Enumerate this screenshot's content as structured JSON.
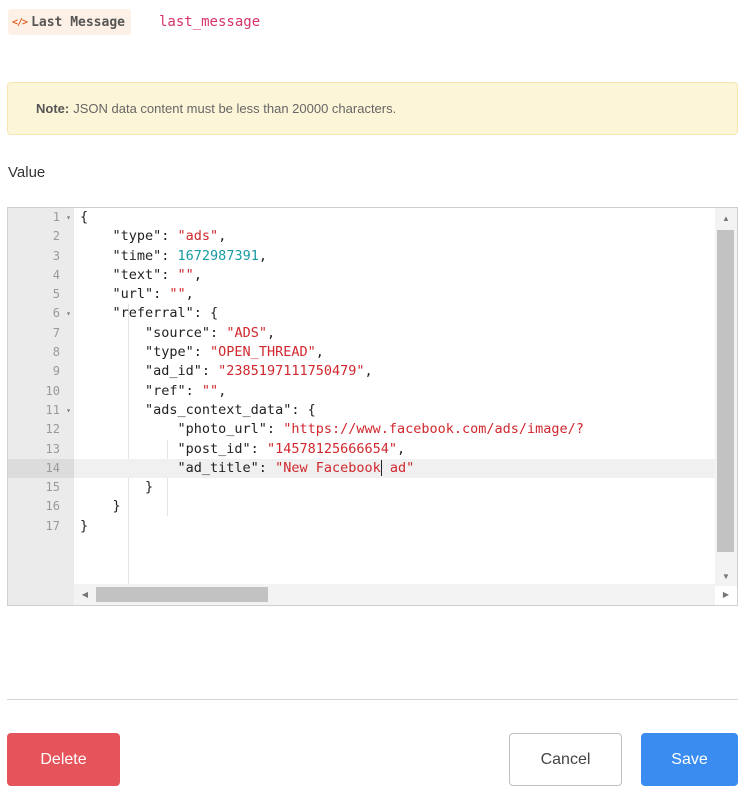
{
  "field": {
    "icon": "code-icon",
    "label": "Last Message",
    "key": "last_message"
  },
  "note": {
    "bold": "Note:",
    "text": "JSON data content must be less than 20000 characters."
  },
  "value_label": "Value",
  "editor": {
    "active_line": 14,
    "lines": [
      {
        "n": "1",
        "fold": true,
        "text": "{"
      },
      {
        "n": "2",
        "fold": false,
        "text": "    \"type\": \"ads\","
      },
      {
        "n": "3",
        "fold": false,
        "text": "    \"time\": 1672987391,"
      },
      {
        "n": "4",
        "fold": false,
        "text": "    \"text\": \"\","
      },
      {
        "n": "5",
        "fold": false,
        "text": "    \"url\": \"\","
      },
      {
        "n": "6",
        "fold": true,
        "text": "    \"referral\": {"
      },
      {
        "n": "7",
        "fold": false,
        "text": "        \"source\": \"ADS\","
      },
      {
        "n": "8",
        "fold": false,
        "text": "        \"type\": \"OPEN_THREAD\","
      },
      {
        "n": "9",
        "fold": false,
        "text": "        \"ad_id\": \"2385197111750479\","
      },
      {
        "n": "10",
        "fold": false,
        "text": "        \"ref\": \"\","
      },
      {
        "n": "11",
        "fold": true,
        "text": "        \"ads_context_data\": {"
      },
      {
        "n": "12",
        "fold": false,
        "text": "            \"photo_url\": \"https://www.facebook.com/ads/image/?"
      },
      {
        "n": "13",
        "fold": false,
        "text": "            \"post_id\": \"14578125666654\","
      },
      {
        "n": "14",
        "fold": false,
        "text": "            \"ad_title\": \"New Facebook ad\""
      },
      {
        "n": "15",
        "fold": false,
        "text": "        }"
      },
      {
        "n": "16",
        "fold": false,
        "text": "    }"
      },
      {
        "n": "17",
        "fold": false,
        "text": "}"
      }
    ]
  },
  "buttons": {
    "delete": "Delete",
    "cancel": "Cancel",
    "save": "Save"
  },
  "colors": {
    "delete": "#e5545a",
    "save": "#3a8cf0",
    "string": "#d0282e",
    "number": "#189aa3"
  }
}
